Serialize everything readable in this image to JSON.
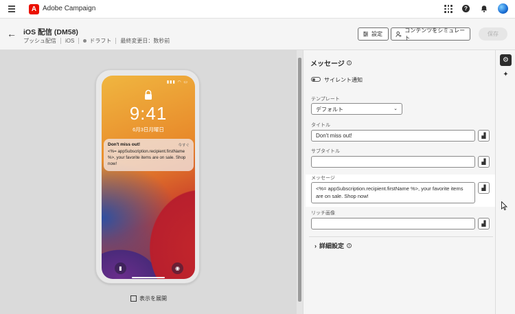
{
  "topbar": {
    "app_name": "Adobe Campaign",
    "logo_letter": "A"
  },
  "header": {
    "title": "iOS 配信 (DM58)",
    "meta": {
      "type": "プッシュ配信",
      "channel": "iOS",
      "status": "ドラフト",
      "modified": "最終変更日：数秒前"
    },
    "buttons": {
      "settings": "設定",
      "simulate": "コンテンツをシミュレート",
      "save": "保存"
    }
  },
  "preview": {
    "clock": "9:41",
    "date": "6月3日月曜日",
    "notification": {
      "title": "Don't miss out!",
      "time": "今すぐ",
      "body": "<%= appSubscription.recipient.firstName %>, your favorite items are on sale. Shop now!"
    },
    "expand_label": "表示を展開"
  },
  "panel": {
    "section_title": "メッセージ",
    "silent_label": "サイレント通知",
    "template_label": "テンプレート",
    "template_value": "デフォルト",
    "title_label": "タイトル",
    "title_value": "Don't miss out!",
    "subtitle_label": "サブタイトル",
    "subtitle_value": "",
    "message_label": "メッセージ",
    "message_value": "<%= appSubscription.recipient.firstName %>, your favorite items are on sale. Shop now!",
    "rich_media_label": "リッチ画像",
    "rich_media_value": "",
    "advanced_label": "詳細設定"
  },
  "colors": {
    "accent": "#eb1000",
    "primary_dark": "#2c2c2c"
  }
}
